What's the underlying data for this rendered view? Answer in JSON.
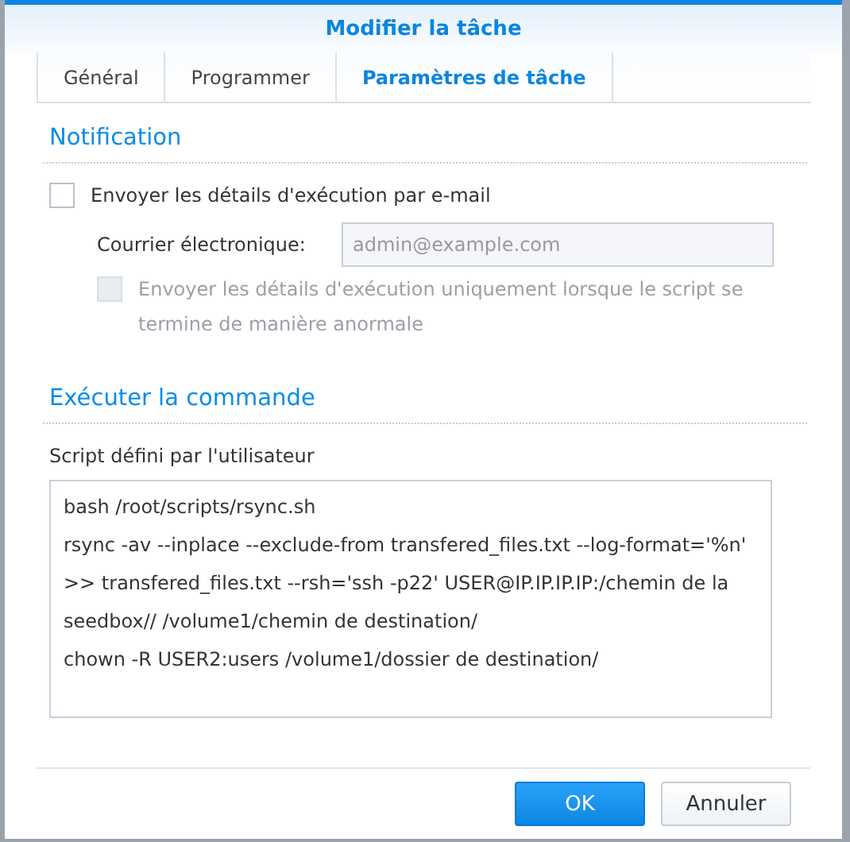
{
  "window": {
    "title": "Modifier la tâche"
  },
  "tabs": [
    {
      "label": "Général",
      "selected": false
    },
    {
      "label": "Programmer",
      "selected": false
    },
    {
      "label": "Paramètres de tâche",
      "selected": true
    }
  ],
  "notification": {
    "heading": "Notification",
    "email_option": {
      "label": "Envoyer les détails d'exécution par e-mail",
      "checked": false,
      "disabled": false
    },
    "email_field": {
      "label": "Courrier électronique:",
      "value": "admin@example.com",
      "disabled": true
    },
    "abnormal_option": {
      "label": "Envoyer les détails d'exécution uniquement lorsque le script se termine de manière anormale",
      "checked": false,
      "disabled": true
    }
  },
  "command": {
    "heading": "Exécuter la commande",
    "script_label": "Script défini par l'utilisateur",
    "script_lines": [
      "bash /root/scripts/rsync.sh",
      "rsync -av --inplace --exclude-from transfered_files.txt --log-format='%n' >> transfered_files.txt --rsh='ssh -p22' USER@IP.IP.IP.IP:/chemin de la seedbox// /volume1/chemin de destination/",
      "chown -R USER2:users /volume1/dossier de destination/"
    ]
  },
  "buttons": [
    {
      "label": "OK",
      "kind": "primary"
    },
    {
      "label": "Annuler",
      "kind": "secondary"
    }
  ]
}
